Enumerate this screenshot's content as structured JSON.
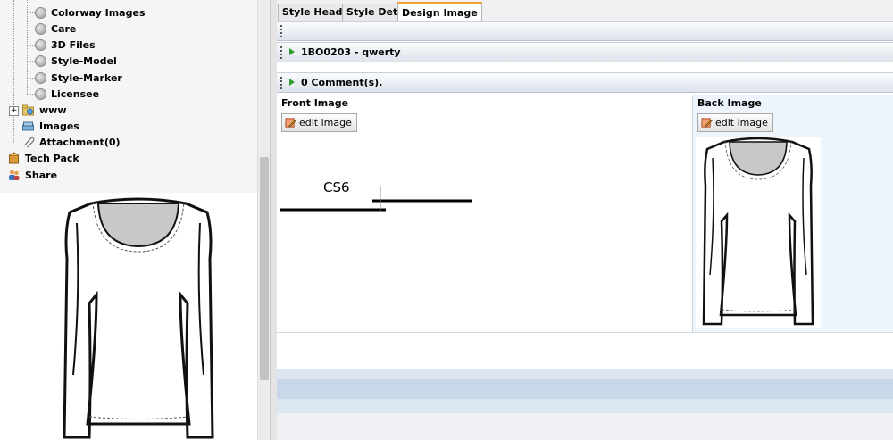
{
  "tree": {
    "items": [
      {
        "label": "Colorway Images"
      },
      {
        "label": "Care"
      },
      {
        "label": "3D Files"
      },
      {
        "label": "Style-Model"
      },
      {
        "label": "Style-Marker"
      },
      {
        "label": "Licensee"
      },
      {
        "label": "www"
      },
      {
        "label": "Images"
      },
      {
        "label": "Attachment(0)"
      },
      {
        "label": "Tech Pack"
      },
      {
        "label": "Share"
      }
    ]
  },
  "tabs": [
    {
      "label": "Style Header"
    },
    {
      "label": "Style Detail"
    },
    {
      "label": "Design Image",
      "active": true
    }
  ],
  "style_bar": {
    "label": "1BO0203 - qwerty"
  },
  "comments_bar": {
    "label": "0 Comment(s)."
  },
  "front": {
    "label": "Front Image",
    "edit_label": "edit image",
    "sketch_text": "CS6"
  },
  "back": {
    "label": "Back Image",
    "edit_label": "edit image"
  },
  "colors": {
    "accent_tab": "#f0a030",
    "arrow": "#2e9b2e",
    "back_panel": "#eef4fb"
  }
}
